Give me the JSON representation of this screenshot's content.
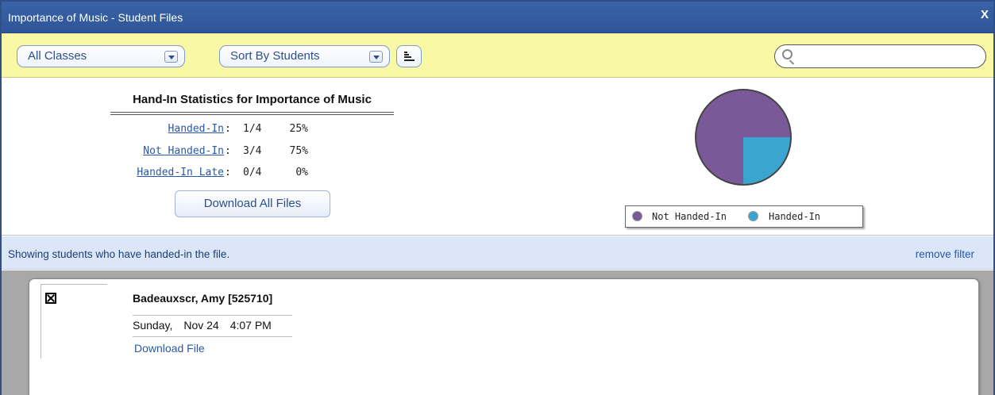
{
  "window": {
    "title": "Importance of Music - Student Files",
    "close_label": "X"
  },
  "toolbar": {
    "class_select": "All Classes",
    "sort_select": "Sort By Students",
    "search_placeholder": ""
  },
  "stats": {
    "title": "Hand-In Statistics for Importance of Music",
    "rows": [
      {
        "label": "Handed-In",
        "count": "1/4",
        "percent": "25%"
      },
      {
        "label": "Not Handed-In",
        "count": "3/4",
        "percent": "75%"
      },
      {
        "label": "Handed-In Late",
        "count": "0/4",
        "percent": "0%"
      }
    ],
    "download_all": "Download All Files"
  },
  "chart_data": {
    "type": "pie",
    "slices": [
      {
        "label": "Not Handed-In",
        "value": 75,
        "color": "#7b5998"
      },
      {
        "label": "Handed-In",
        "value": 25,
        "color": "#3aa6d0"
      }
    ],
    "legend": [
      "Not Handed-In",
      "Handed-In"
    ],
    "legend_placement": "bottom"
  },
  "filter": {
    "message": "Showing students who have handed-in the file.",
    "remove": "remove filter"
  },
  "students": [
    {
      "name": "Badeauxscr, Amy  [525710]",
      "day": "Sunday,",
      "date": "Nov 24",
      "time": "4:07 PM",
      "download": "Download File"
    }
  ],
  "colors": {
    "titlebar": "#2e5597",
    "toolbar": "#f9f8a4",
    "filterbar": "#dbe6f8",
    "link": "#2b58a6"
  }
}
